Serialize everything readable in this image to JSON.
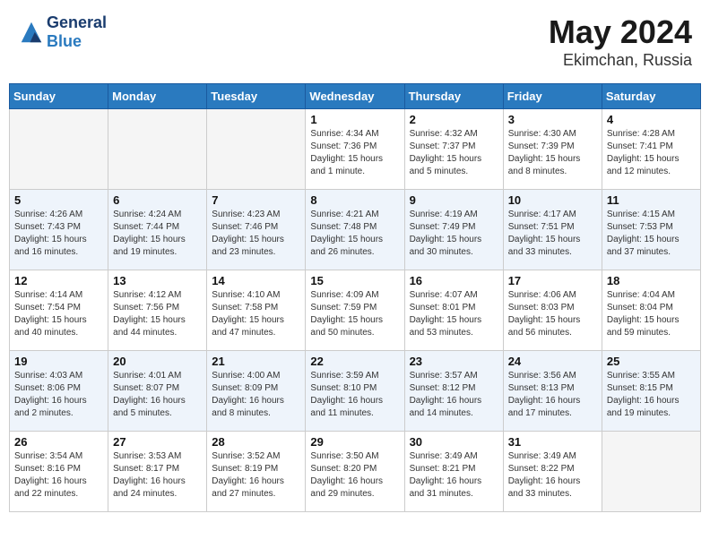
{
  "header": {
    "logo_line1": "General",
    "logo_line2": "Blue",
    "month_year": "May 2024",
    "location": "Ekimchan, Russia"
  },
  "weekdays": [
    "Sunday",
    "Monday",
    "Tuesday",
    "Wednesday",
    "Thursday",
    "Friday",
    "Saturday"
  ],
  "weeks": [
    [
      {
        "day": "",
        "empty": true
      },
      {
        "day": "",
        "empty": true
      },
      {
        "day": "",
        "empty": true
      },
      {
        "day": "1",
        "info": "Sunrise: 4:34 AM\nSunset: 7:36 PM\nDaylight: 15 hours\nand 1 minute."
      },
      {
        "day": "2",
        "info": "Sunrise: 4:32 AM\nSunset: 7:37 PM\nDaylight: 15 hours\nand 5 minutes."
      },
      {
        "day": "3",
        "info": "Sunrise: 4:30 AM\nSunset: 7:39 PM\nDaylight: 15 hours\nand 8 minutes."
      },
      {
        "day": "4",
        "info": "Sunrise: 4:28 AM\nSunset: 7:41 PM\nDaylight: 15 hours\nand 12 minutes."
      }
    ],
    [
      {
        "day": "5",
        "info": "Sunrise: 4:26 AM\nSunset: 7:43 PM\nDaylight: 15 hours\nand 16 minutes."
      },
      {
        "day": "6",
        "info": "Sunrise: 4:24 AM\nSunset: 7:44 PM\nDaylight: 15 hours\nand 19 minutes."
      },
      {
        "day": "7",
        "info": "Sunrise: 4:23 AM\nSunset: 7:46 PM\nDaylight: 15 hours\nand 23 minutes."
      },
      {
        "day": "8",
        "info": "Sunrise: 4:21 AM\nSunset: 7:48 PM\nDaylight: 15 hours\nand 26 minutes."
      },
      {
        "day": "9",
        "info": "Sunrise: 4:19 AM\nSunset: 7:49 PM\nDaylight: 15 hours\nand 30 minutes."
      },
      {
        "day": "10",
        "info": "Sunrise: 4:17 AM\nSunset: 7:51 PM\nDaylight: 15 hours\nand 33 minutes."
      },
      {
        "day": "11",
        "info": "Sunrise: 4:15 AM\nSunset: 7:53 PM\nDaylight: 15 hours\nand 37 minutes."
      }
    ],
    [
      {
        "day": "12",
        "info": "Sunrise: 4:14 AM\nSunset: 7:54 PM\nDaylight: 15 hours\nand 40 minutes."
      },
      {
        "day": "13",
        "info": "Sunrise: 4:12 AM\nSunset: 7:56 PM\nDaylight: 15 hours\nand 44 minutes."
      },
      {
        "day": "14",
        "info": "Sunrise: 4:10 AM\nSunset: 7:58 PM\nDaylight: 15 hours\nand 47 minutes."
      },
      {
        "day": "15",
        "info": "Sunrise: 4:09 AM\nSunset: 7:59 PM\nDaylight: 15 hours\nand 50 minutes."
      },
      {
        "day": "16",
        "info": "Sunrise: 4:07 AM\nSunset: 8:01 PM\nDaylight: 15 hours\nand 53 minutes."
      },
      {
        "day": "17",
        "info": "Sunrise: 4:06 AM\nSunset: 8:03 PM\nDaylight: 15 hours\nand 56 minutes."
      },
      {
        "day": "18",
        "info": "Sunrise: 4:04 AM\nSunset: 8:04 PM\nDaylight: 15 hours\nand 59 minutes."
      }
    ],
    [
      {
        "day": "19",
        "info": "Sunrise: 4:03 AM\nSunset: 8:06 PM\nDaylight: 16 hours\nand 2 minutes."
      },
      {
        "day": "20",
        "info": "Sunrise: 4:01 AM\nSunset: 8:07 PM\nDaylight: 16 hours\nand 5 minutes."
      },
      {
        "day": "21",
        "info": "Sunrise: 4:00 AM\nSunset: 8:09 PM\nDaylight: 16 hours\nand 8 minutes."
      },
      {
        "day": "22",
        "info": "Sunrise: 3:59 AM\nSunset: 8:10 PM\nDaylight: 16 hours\nand 11 minutes."
      },
      {
        "day": "23",
        "info": "Sunrise: 3:57 AM\nSunset: 8:12 PM\nDaylight: 16 hours\nand 14 minutes."
      },
      {
        "day": "24",
        "info": "Sunrise: 3:56 AM\nSunset: 8:13 PM\nDaylight: 16 hours\nand 17 minutes."
      },
      {
        "day": "25",
        "info": "Sunrise: 3:55 AM\nSunset: 8:15 PM\nDaylight: 16 hours\nand 19 minutes."
      }
    ],
    [
      {
        "day": "26",
        "info": "Sunrise: 3:54 AM\nSunset: 8:16 PM\nDaylight: 16 hours\nand 22 minutes."
      },
      {
        "day": "27",
        "info": "Sunrise: 3:53 AM\nSunset: 8:17 PM\nDaylight: 16 hours\nand 24 minutes."
      },
      {
        "day": "28",
        "info": "Sunrise: 3:52 AM\nSunset: 8:19 PM\nDaylight: 16 hours\nand 27 minutes."
      },
      {
        "day": "29",
        "info": "Sunrise: 3:50 AM\nSunset: 8:20 PM\nDaylight: 16 hours\nand 29 minutes."
      },
      {
        "day": "30",
        "info": "Sunrise: 3:49 AM\nSunset: 8:21 PM\nDaylight: 16 hours\nand 31 minutes."
      },
      {
        "day": "31",
        "info": "Sunrise: 3:49 AM\nSunset: 8:22 PM\nDaylight: 16 hours\nand 33 minutes."
      },
      {
        "day": "",
        "empty": true
      }
    ]
  ]
}
